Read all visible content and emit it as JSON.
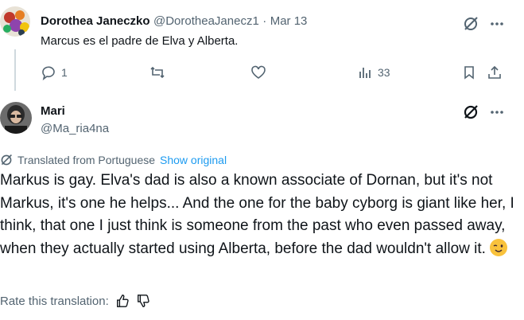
{
  "reply_tweet": {
    "author_name": "Dorothea Janeczko",
    "author_handle": "@DorotheaJanecz1",
    "separator": "·",
    "date": "Mar 13",
    "text": "Marcus es el padre de Elva y Alberta.",
    "reply_count": "1",
    "view_count": "33",
    "icons": [
      "grok-icon",
      "more-icon",
      "reply-icon",
      "retweet-icon",
      "like-icon",
      "views-icon",
      "bookmark-icon",
      "share-icon"
    ]
  },
  "main_tweet": {
    "author_name": "Mari",
    "author_handle": "@Ma_ria4na",
    "translated_label": "Translated from Portuguese",
    "show_original_label": "Show original",
    "text": "Markus is gay. Elva's dad is also a known associate of Dornan, but it's not Markus, it's one he helps... And the one for the baby cyborg is giant like her, I think, that one I just think is someone from the past who even passed away, when they actually started using Alberta, before the dad wouldn't allow it.",
    "emoji": "winking-face",
    "rate_label": "Rate this translation:"
  },
  "colors": {
    "text": "#0f1419",
    "muted": "#536471",
    "link": "#1d9bf0",
    "thread_line": "#cfd9de"
  }
}
